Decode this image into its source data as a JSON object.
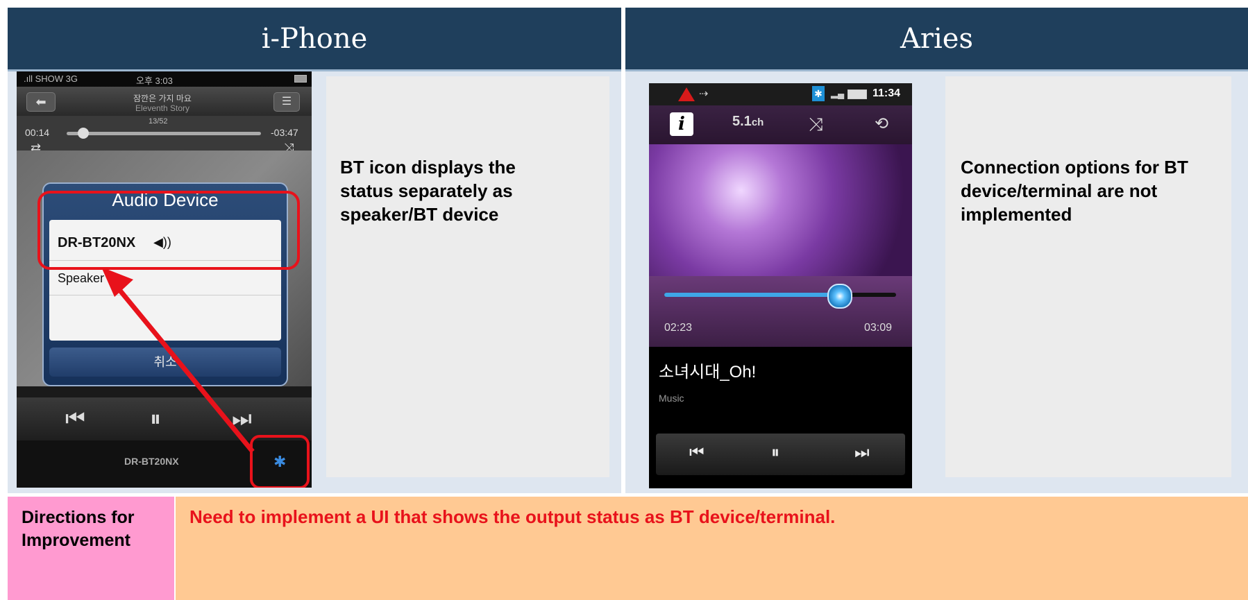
{
  "headers": {
    "left": "i-Phone",
    "right": "Aries"
  },
  "iphone": {
    "status_bar": {
      "carrier": ".ıll SHOW 3G",
      "time": "오후 3:03"
    },
    "song_title": "잠깐은 가지 마요",
    "song_artist": "Eleventh Story",
    "track_counter": "13/52",
    "elapsed": "00:14",
    "remaining": "-03:47",
    "progress": 0.07,
    "dialog": {
      "title": "Audio Device",
      "items": [
        "DR-BT20NX",
        "Speaker"
      ],
      "cancel": "취소"
    },
    "device_name": "DR-BT20NX"
  },
  "iphone_note": "BT icon displays the status separately as speaker/BT device",
  "aries": {
    "status_time": "11:34",
    "surround_label": "5.1",
    "surround_unit": "ch",
    "elapsed": "02:23",
    "total": "03:09",
    "progress": 0.74,
    "track_title": "소녀시대_Oh!",
    "track_subtitle": "Music"
  },
  "aries_note": "Connection options for BT device/terminal are not implemented",
  "improvement": {
    "label": "Directions for Improvement",
    "text": "Need to implement a UI that shows the output status as BT device/terminal."
  },
  "colors": {
    "header_bg": "#1f3f5c",
    "label_bg": "#ff9ad0",
    "body_bg": "#ffc993",
    "highlight_red": "#e8121b"
  }
}
